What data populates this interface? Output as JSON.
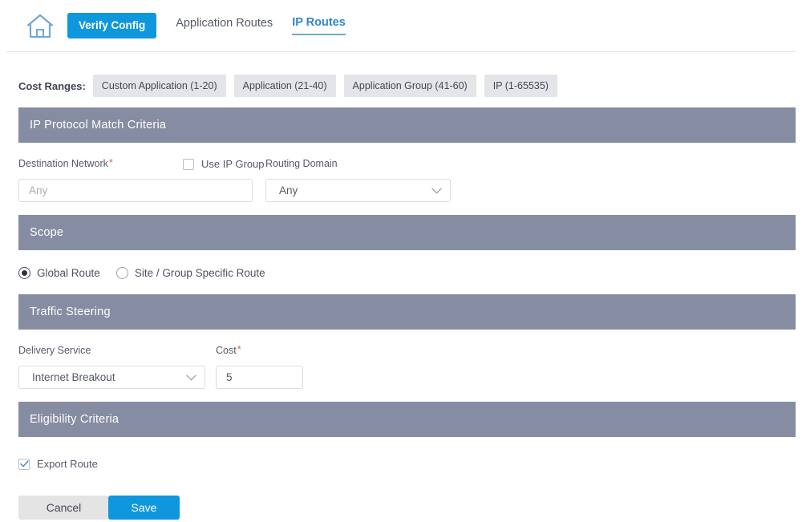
{
  "nav": {
    "home_icon": "home-icon",
    "verify_config_label": "Verify Config",
    "tabs": [
      {
        "label": "Application Routes",
        "active": false
      },
      {
        "label": "IP Routes",
        "active": true
      }
    ]
  },
  "cost_ranges": {
    "label": "Cost Ranges:",
    "chips": [
      "Custom Application (1-20)",
      "Application (21-40)",
      "Application Group (41-60)",
      "IP (1-65535)"
    ]
  },
  "sections": {
    "ip_protocol": {
      "title": "IP Protocol Match Criteria",
      "destination_network_label": "Destination Network",
      "destination_network_required": "*",
      "destination_network_value": "",
      "destination_network_placeholder": "Any",
      "use_ip_group_label": "Use IP Group",
      "use_ip_group_checked": false,
      "routing_domain_label": "Routing Domain",
      "routing_domain_value": "Any"
    },
    "scope": {
      "title": "Scope",
      "options": [
        {
          "label": "Global Route",
          "selected": true
        },
        {
          "label": "Site / Group Specific Route",
          "selected": false
        }
      ]
    },
    "traffic_steering": {
      "title": "Traffic Steering",
      "delivery_service_label": "Delivery Service",
      "delivery_service_value": "Internet Breakout",
      "cost_label": "Cost",
      "cost_required": "*",
      "cost_value": "5"
    },
    "eligibility": {
      "title": "Eligibility Criteria",
      "export_route_label": "Export Route",
      "export_route_checked": true
    }
  },
  "footer": {
    "cancel_label": "Cancel",
    "save_label": "Save"
  },
  "colors": {
    "accent_blue": "#0f97dd",
    "section_bar": "#868da3",
    "required_red": "#e8604c",
    "chip_gray": "#e4e5e8"
  }
}
